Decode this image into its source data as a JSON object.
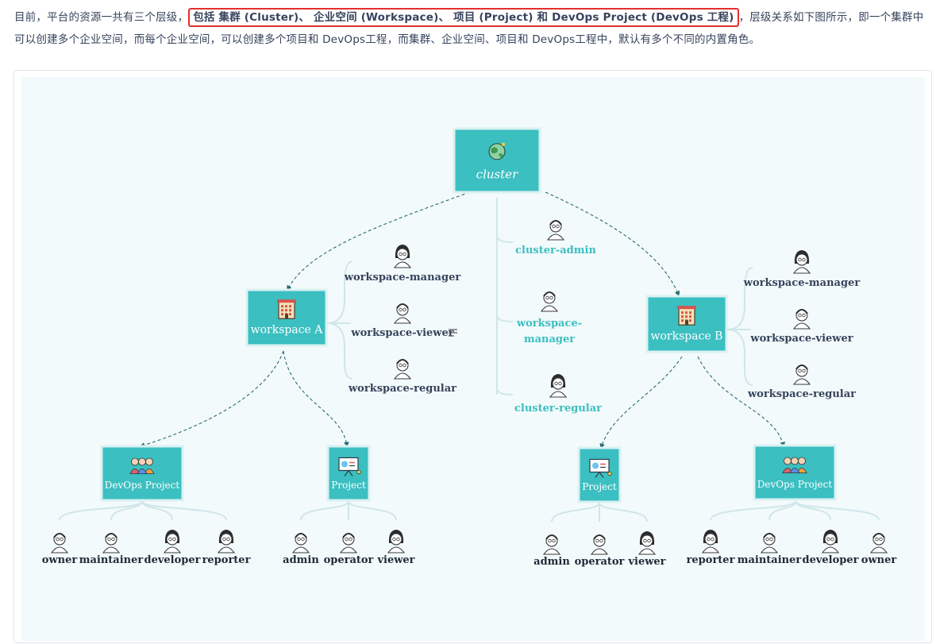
{
  "intro": {
    "before": "目前，平台的资源一共有三个层级，",
    "highlight": "包括 集群 (Cluster)、 企业空间 (Workspace)、 项目 (Project) 和 DevOps Project (DevOps 工程)",
    "after": "，层级关系如下图所示，即一个集群中可以创建多个企业空间，而每个企业空间，可以创建多个项目和 DevOps工程，而集群、企业空间、项目和 DevOps工程中，默认有多个不同的内置角色。"
  },
  "colors": {
    "node": "#3bbfc1",
    "node_border": "#2aa7a9",
    "text": "#36435c",
    "accent_text": "#3bbfc1",
    "arrow": "#266b73",
    "branch": "#cfe6ea"
  },
  "diagram": {
    "cluster": {
      "label": "cluster",
      "icon": "globe-icon"
    },
    "cluster_roles": [
      "cluster-admin",
      "workspace-\nmanager",
      "cluster-regular"
    ],
    "workspaces": [
      {
        "label": "workspace A",
        "icon": "building-icon",
        "roles": [
          "workspace-manager",
          "workspace-viewer",
          "workspace-regular"
        ]
      },
      {
        "label": "workspace B",
        "icon": "building-icon",
        "roles": [
          "workspace-manager",
          "workspace-viewer",
          "workspace-regular"
        ]
      }
    ],
    "projects": [
      {
        "label": "DevOps Project",
        "icon": "team-icon",
        "roles": [
          "owner",
          "maintainer",
          "developer",
          "reporter"
        ]
      },
      {
        "label": "Project",
        "icon": "presentation-icon",
        "roles": [
          "admin",
          "operator",
          "viewer"
        ]
      },
      {
        "label": "Project",
        "icon": "presentation-icon",
        "roles": [
          "admin",
          "operator",
          "viewer"
        ]
      },
      {
        "label": "DevOps Project",
        "icon": "team-icon",
        "roles": [
          "reporter",
          "maintainer",
          "developer",
          "owner"
        ]
      }
    ]
  }
}
